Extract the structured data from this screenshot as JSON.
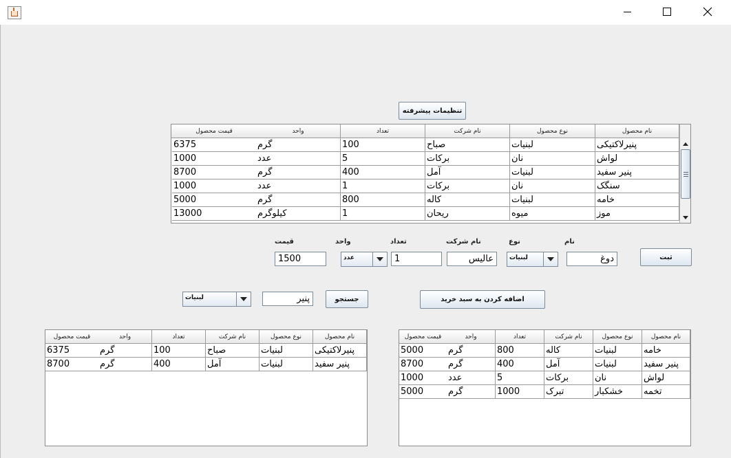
{
  "window": {
    "icon": "java-cup-icon",
    "controls": [
      "minimize-icon",
      "maximize-icon",
      "close-icon"
    ]
  },
  "settings_button": "تنظیمات پیشرفته",
  "columns": [
    "نام محصول",
    "نوع محصول",
    "نام شرکت",
    "تعداد",
    "واحد",
    "قیمت محصول"
  ],
  "main_table": {
    "rows": [
      [
        "پنیرلاکتیکی",
        "لبنیات",
        "صباح",
        "100",
        "گرم",
        "6375"
      ],
      [
        "لواش",
        "نان",
        "برکات",
        "5",
        "عدد",
        "1000"
      ],
      [
        "پنیر سفید",
        "لبنیات",
        "آمل",
        "400",
        "گرم",
        "8700"
      ],
      [
        "سنگک",
        "نان",
        "برکات",
        "1",
        "عدد",
        "1000"
      ],
      [
        "خامه",
        "لبنیات",
        "کاله",
        "800",
        "گرم",
        "5000"
      ],
      [
        "موز",
        "میوه",
        "ریحان",
        "1",
        "کیلوگرم",
        "13000"
      ]
    ]
  },
  "form": {
    "labels": {
      "name": "نام",
      "type": "نوع",
      "company": "نام شرکت",
      "count": "تعداد",
      "unit": "واحد",
      "price": "قیمت"
    },
    "values": {
      "name": "دوغ",
      "type": "لبنیات",
      "company": "عالیس",
      "count": "1",
      "unit": "عدد",
      "price": "1500"
    },
    "submit_button": "ثبت"
  },
  "search": {
    "filter_type": "لبنیات",
    "query": "پنیر",
    "search_button": "جستجو",
    "add_to_cart_button": "اضافه کردن به سبد خرید"
  },
  "search_results": {
    "rows": [
      [
        "پنیرلاکتیکی",
        "لبنیات",
        "صباح",
        "100",
        "گرم",
        "6375"
      ],
      [
        "پنیر سفید",
        "لبنیات",
        "آمل",
        "400",
        "گرم",
        "8700"
      ]
    ]
  },
  "cart": {
    "rows": [
      [
        "خامه",
        "لبنیات",
        "کاله",
        "800",
        "گرم",
        "5000"
      ],
      [
        "پنیر سفید",
        "لبنیات",
        "آمل",
        "400",
        "گرم",
        "8700"
      ],
      [
        "لواش",
        "نان",
        "برکات",
        "5",
        "عدد",
        "1000"
      ],
      [
        "تخمه",
        "خشکبار",
        "تبرک",
        "1000",
        "گرم",
        "5000"
      ]
    ]
  }
}
